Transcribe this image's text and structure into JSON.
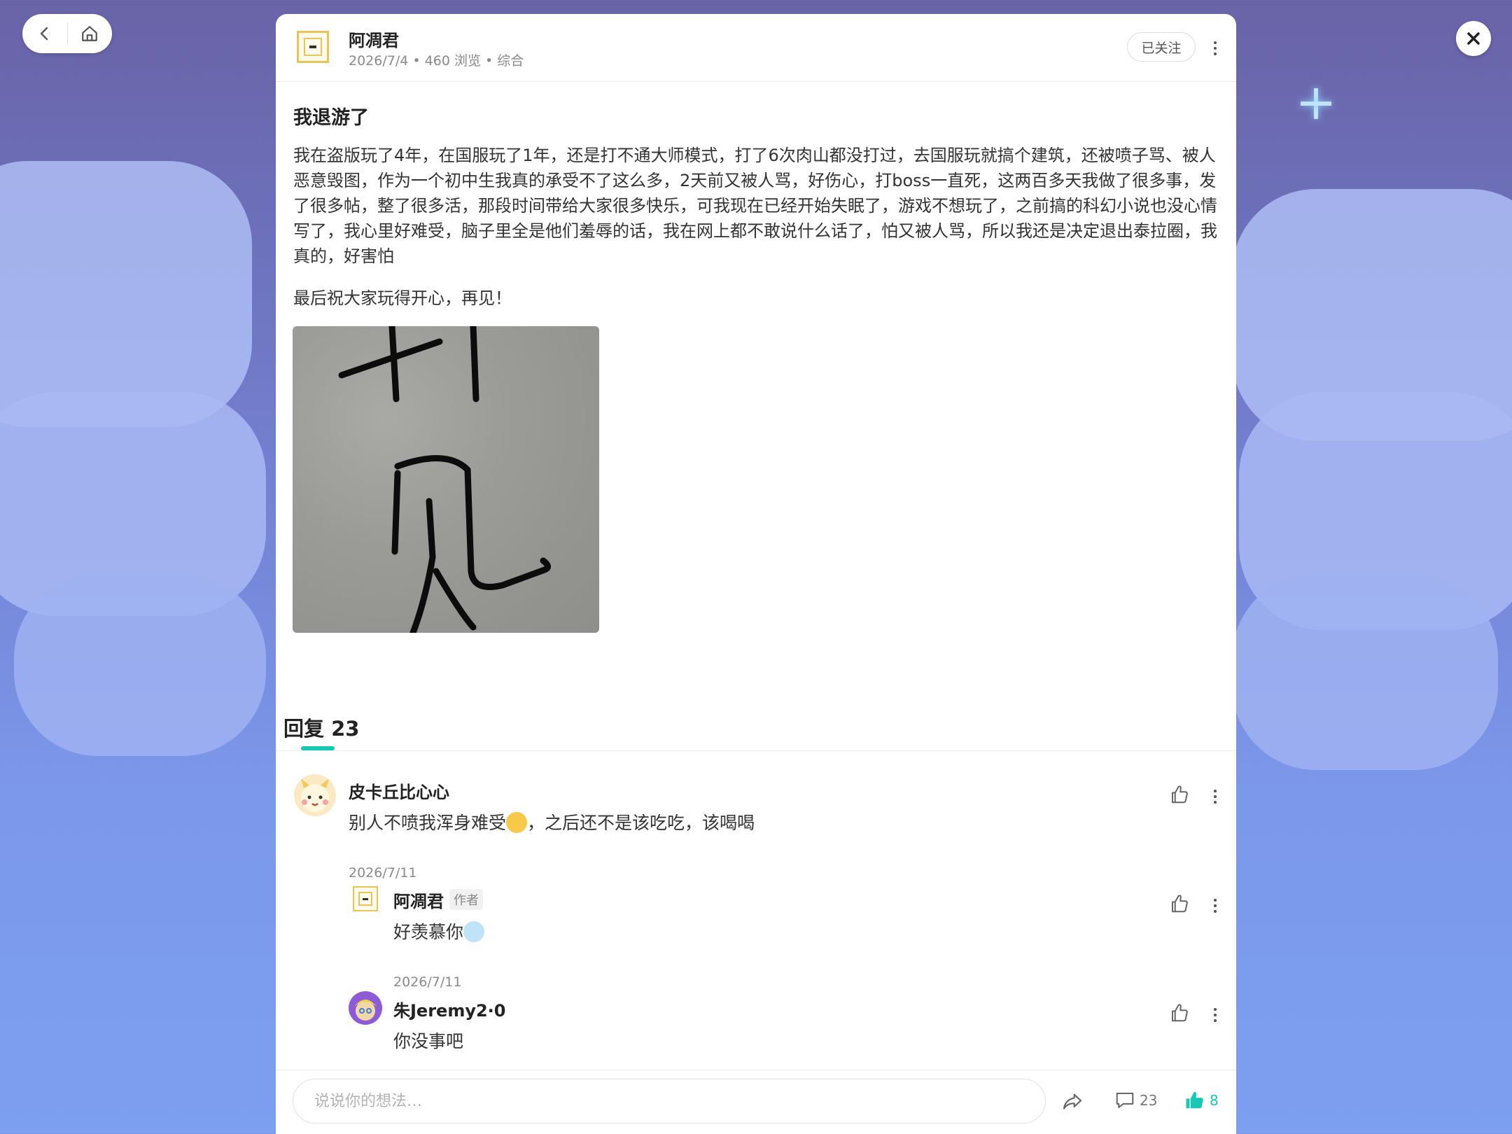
{
  "nav": {
    "back_icon": "chevron-left-icon",
    "home_icon": "home-icon"
  },
  "close_icon": "close-icon",
  "post": {
    "author": "阿凋君",
    "date": "2026/7/4",
    "views": "460 浏览",
    "category": "综合",
    "follow_label": "已关注",
    "title": "我退游了",
    "body": "我在盗版玩了4年，在国服玩了1年，还是打不通大师模式，打了6次肉山都没打过，去国服玩就搞个建筑，还被喷子骂、被人恶意毁图，作为一个初中生我真的承受不了这么多，2天前又被人骂，好伤心，打boss一直死，这两百多天我做了很多事，发了很多帖，整了很多活，那段时间带给大家很多快乐，可我现在已经开始失眠了，游戏不想玩了，之前搞的科幻小说也没心情写了，我心里好难受，脑子里全是他们羞辱的话，我在网上都不敢说什么话了，怕又被人骂，所以我还是决定退出泰拉圈，我真的，好害怕",
    "farewell": "最后祝大家玩得开心，再见！",
    "image_text": "再见"
  },
  "replies": {
    "label": "回复",
    "count": "23",
    "accent_color": "#18c7b4",
    "items": [
      {
        "name": "皮卡丘比心心",
        "text_before": "别人不喷我浑身难受",
        "emoji": "smirk-emoji",
        "text_after": "，之后还不是该吃吃，该喝喝",
        "date": "2026/7/11"
      },
      {
        "name": "阿凋君",
        "tag": "作者",
        "text_before": "好羡慕你",
        "emoji": "crying-emoji",
        "date": "2026/7/11"
      },
      {
        "name": "朱Jeremy2·0",
        "text_before": "你没事吧"
      }
    ]
  },
  "bottom": {
    "placeholder": "说说你的想法…",
    "share_icon": "share-icon",
    "comment_icon": "comment-icon",
    "comment_count": "23",
    "like_icon": "thumbs-up-icon",
    "like_count": "8",
    "like_color": "#18c7b4"
  }
}
